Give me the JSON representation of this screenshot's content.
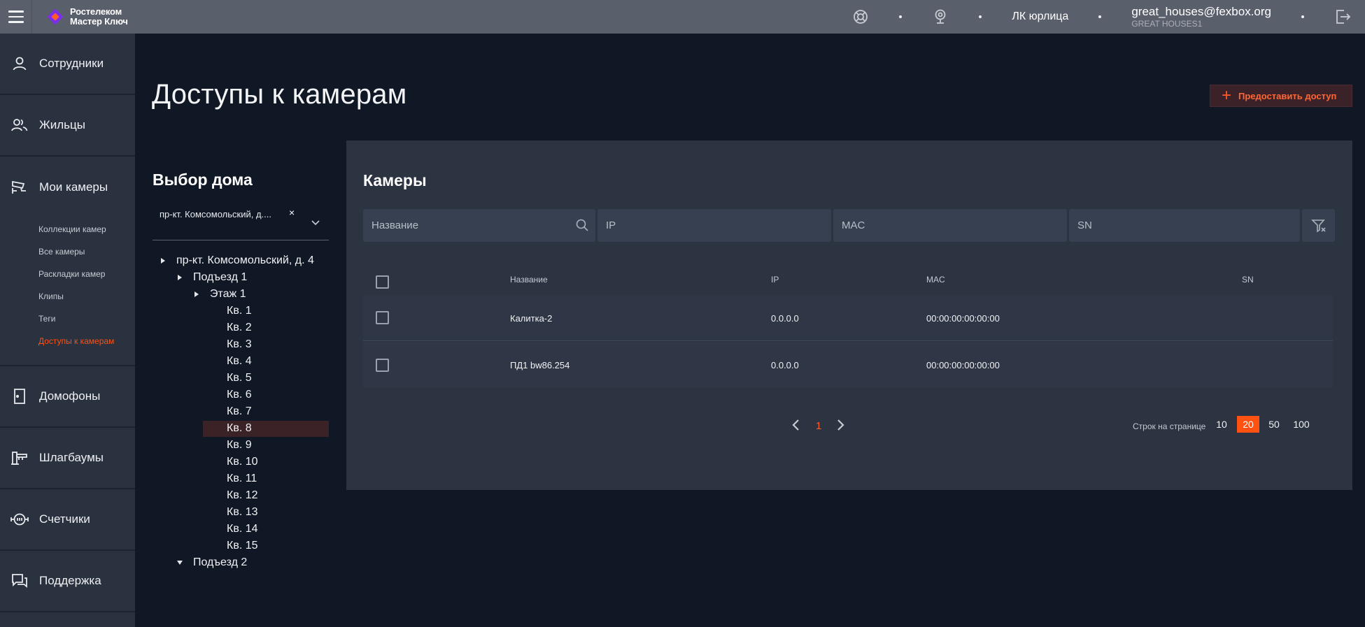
{
  "header": {
    "logo_line1": "Ростелеком",
    "logo_line2": "Мастер Ключ",
    "account_link": "ЛК юрлица",
    "user_email": "great_houses@fexbox.org",
    "user_org": "GREAT HOUSES1",
    "icons": [
      "menu-icon",
      "support-lifebuoy-icon",
      "webcam-icon",
      "logout-icon"
    ]
  },
  "sidebar": {
    "items": [
      {
        "label": "Сотрудники",
        "icon": "person-icon"
      },
      {
        "label": "Жильцы",
        "icon": "people-icon"
      },
      {
        "label": "Мои камеры",
        "icon": "cctv-icon"
      },
      {
        "label": "Домофоны",
        "icon": "door-icon"
      },
      {
        "label": "Шлагбаумы",
        "icon": "barrier-icon"
      },
      {
        "label": "Счетчики",
        "icon": "meter-icon"
      },
      {
        "label": "Поддержка",
        "icon": "chat-icon"
      }
    ],
    "camera_sub": [
      {
        "label": "Коллекции камер"
      },
      {
        "label": "Все камеры"
      },
      {
        "label": "Раскладки камер"
      },
      {
        "label": "Клипы"
      },
      {
        "label": "Теги"
      },
      {
        "label": "Доступы к камерам"
      }
    ]
  },
  "main": {
    "title": "Доступы к камерам",
    "grant_button": "Предоставить доступ"
  },
  "house_panel": {
    "title": "Выбор дома",
    "selected_value": "пр-кт. Комсомольский, д....",
    "clear_glyph": "×",
    "tree": [
      {
        "label": "пр-кт. Комсомольский, д. 4"
      },
      {
        "label": "Подъезд 1"
      },
      {
        "label": "Этаж 1"
      },
      {
        "label": "Кв. 1"
      },
      {
        "label": "Кв. 2"
      },
      {
        "label": "Кв. 3"
      },
      {
        "label": "Кв. 4"
      },
      {
        "label": "Кв. 5"
      },
      {
        "label": "Кв. 6"
      },
      {
        "label": "Кв. 7"
      },
      {
        "label": "Кв. 8",
        "selected": true
      },
      {
        "label": "Кв. 9"
      },
      {
        "label": "Кв. 10"
      },
      {
        "label": "Кв. 11"
      },
      {
        "label": "Кв. 12"
      },
      {
        "label": "Кв. 13"
      },
      {
        "label": "Кв. 14"
      },
      {
        "label": "Кв. 15"
      },
      {
        "label": "Подъезд 2"
      }
    ]
  },
  "cameras": {
    "title": "Камеры",
    "filters": {
      "name_placeholder": "Название",
      "ip_placeholder": "IP",
      "mac_placeholder": "MAC",
      "sn_placeholder": "SN"
    },
    "columns": [
      "Название",
      "IP",
      "MAC",
      "SN"
    ],
    "rows": [
      {
        "name": "Калитка-2",
        "ip": "0.0.0.0",
        "mac": "00:00:00:00:00:00",
        "sn": ""
      },
      {
        "name": "ПД1 bw86.254",
        "ip": "0.0.0.0",
        "mac": "00:00:00:00:00:00",
        "sn": ""
      }
    ],
    "pagination": {
      "current_page": "1",
      "rows_label": "Строк на странице",
      "rows_options": [
        "10",
        "20",
        "50",
        "100"
      ],
      "rows_selected": "20"
    }
  },
  "colors": {
    "accent": "#ff5212",
    "background": "#101826",
    "sidebar": "#2b323f",
    "topbar": "#5a5f6c",
    "card": "#2c3441"
  }
}
